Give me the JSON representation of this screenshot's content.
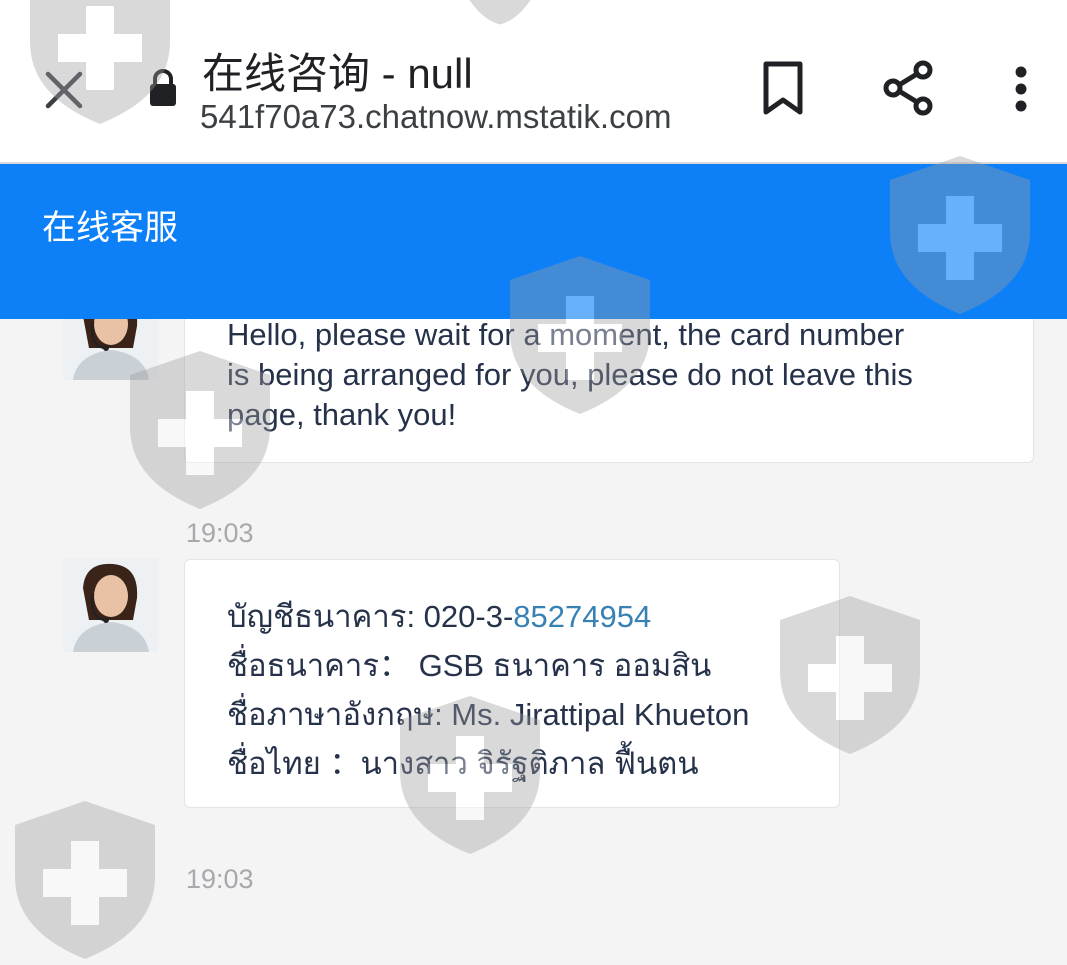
{
  "browser": {
    "title": "在线咨询 - null",
    "url": "541f70a73.chatnow.mstatik.com",
    "icons": [
      "close-icon",
      "lock-icon",
      "bookmark-icon",
      "share-icon",
      "more-vert-icon"
    ]
  },
  "chat": {
    "header_title": "在线客服",
    "header_color": "#0d80f8",
    "messages": [
      {
        "text": "Hello, please wait for a moment, the card number\nis being arranged for you, please do not leave this\npage, thank you!"
      },
      {
        "timestamp": "19:03",
        "lines": {
          "account_prefix": "บัญชีธนาคาร: 020-3-",
          "account_link": "85274954",
          "bank": "ชื่อธนาคาร： GSB ธนาคาร ออมสิน",
          "english_name": "ชื่อภาษาอังกฤษ: Ms. Jirattipal Khueton",
          "thai_name": "ชื่อไทย ：นางสาว จิรัฐติภาล ฟื้นตน"
        }
      },
      {
        "timestamp": "19:03"
      }
    ]
  },
  "watermark": {
    "icon": "shield-plus-icon",
    "color": "#9e9ea0"
  }
}
